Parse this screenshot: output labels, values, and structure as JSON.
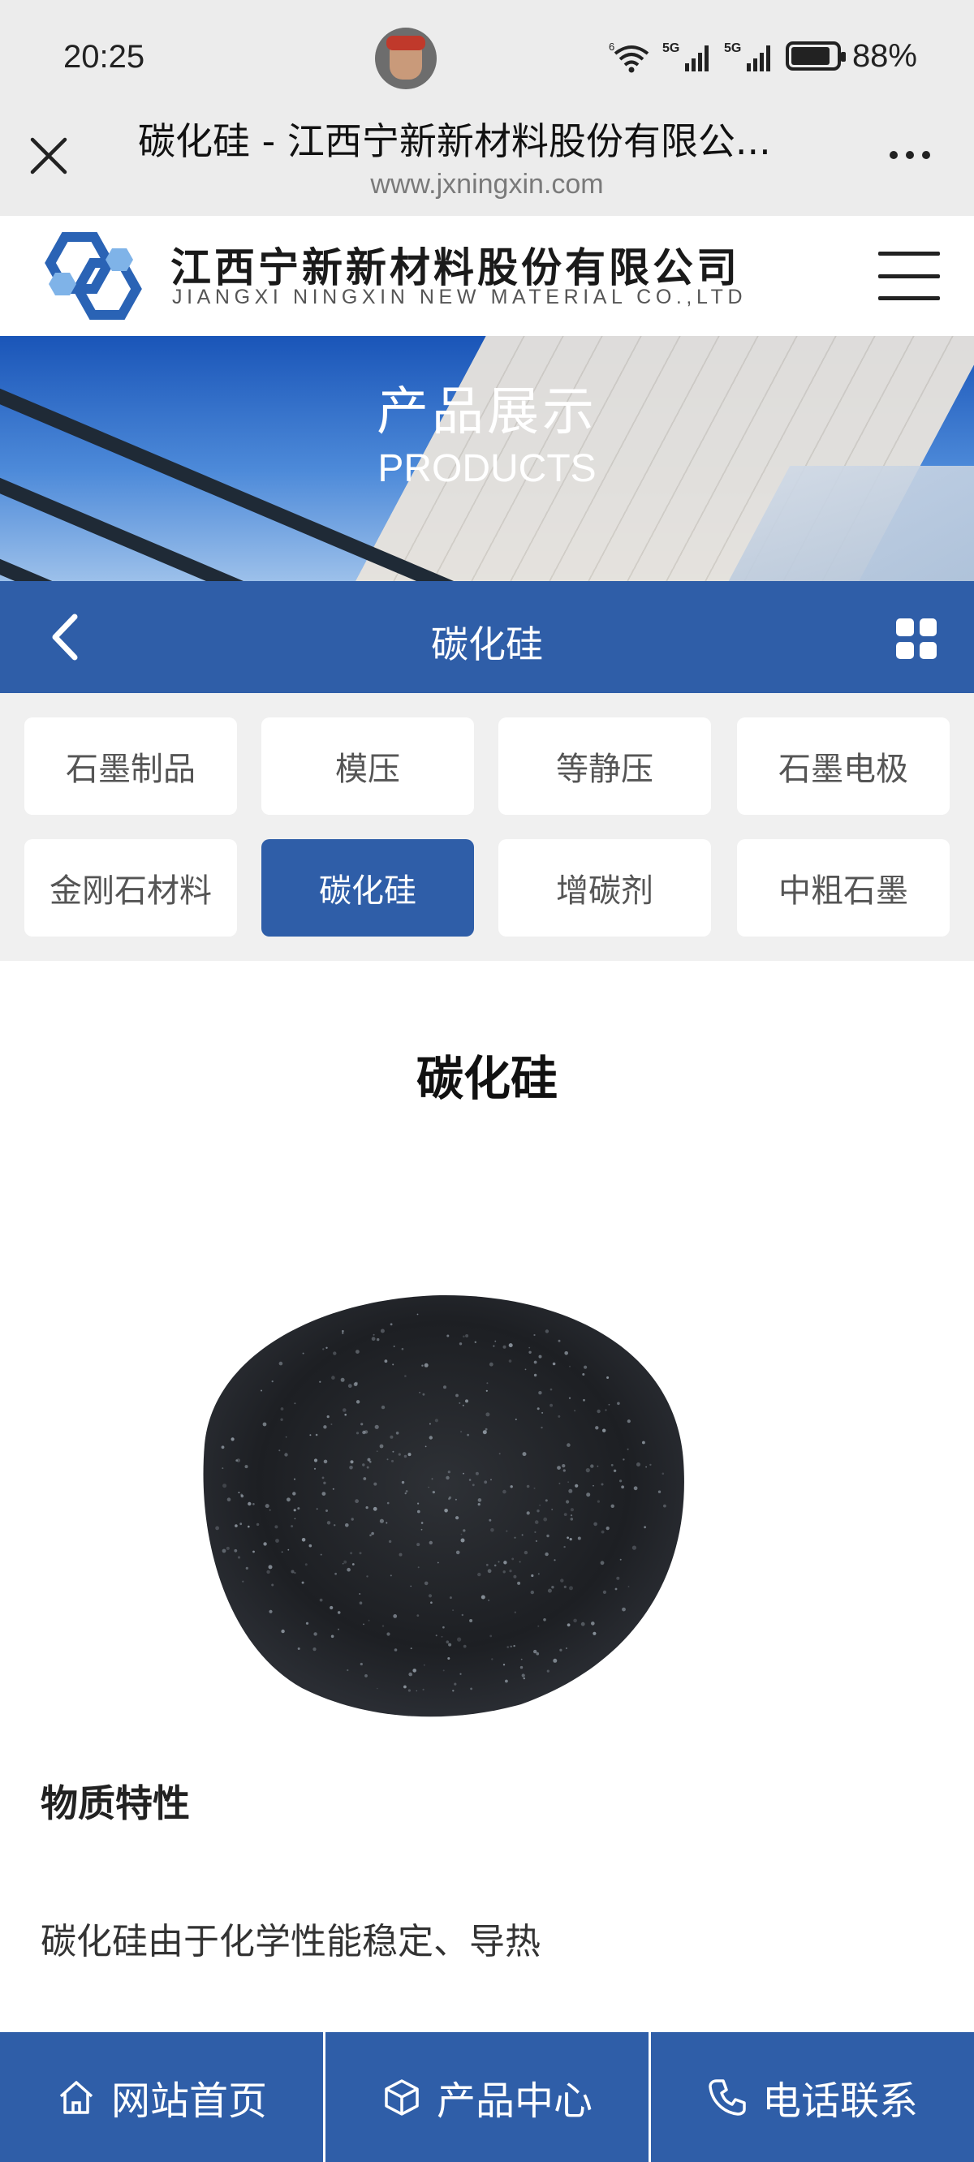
{
  "status_bar": {
    "time": "20:25",
    "battery_percent": "88%",
    "battery_level": 0.88,
    "icons": [
      "notification-avatar-icon",
      "wifi-6-icon",
      "signal-5g-icon",
      "signal-5g-icon",
      "battery-icon"
    ]
  },
  "browser": {
    "title": "碳化硅 - 江西宁新新材料股份有限公...",
    "url": "www.jxningxin.com",
    "close_icon": "close-icon",
    "more_icon": "more-dots-icon"
  },
  "site_header": {
    "logo_cn": "江西宁新新材料股份有限公司",
    "logo_en": "JIANGXI NINGXIN NEW MATERIAL CO.,LTD",
    "menu_icon": "hamburger-icon"
  },
  "banner": {
    "title": "产品展示",
    "subtitle": "PRODUCTS"
  },
  "navbar": {
    "title": "碳化硅",
    "back_icon": "chevron-left-icon",
    "grid_icon": "grid-icon"
  },
  "categories": {
    "items": [
      {
        "label": "石墨制品"
      },
      {
        "label": "模压"
      },
      {
        "label": "等静压"
      },
      {
        "label": "石墨电极"
      },
      {
        "label": "金刚石材料"
      },
      {
        "label": "碳化硅"
      },
      {
        "label": "增碳剂"
      },
      {
        "label": "中粗石墨"
      }
    ],
    "active": "碳化硅"
  },
  "content": {
    "title": "碳化硅",
    "section_heading": "物质特性",
    "section_text": "碳化硅由于化学性能稳定、导热"
  },
  "bottom_bar": {
    "items": [
      {
        "label": "网站首页",
        "icon": "home-icon"
      },
      {
        "label": "产品中心",
        "icon": "box-icon"
      },
      {
        "label": "电话联系",
        "icon": "phone-icon"
      }
    ]
  },
  "colors": {
    "primary": "#2f5ea8",
    "status_bg": "#ececec",
    "category_bg": "#f0f0f0"
  }
}
